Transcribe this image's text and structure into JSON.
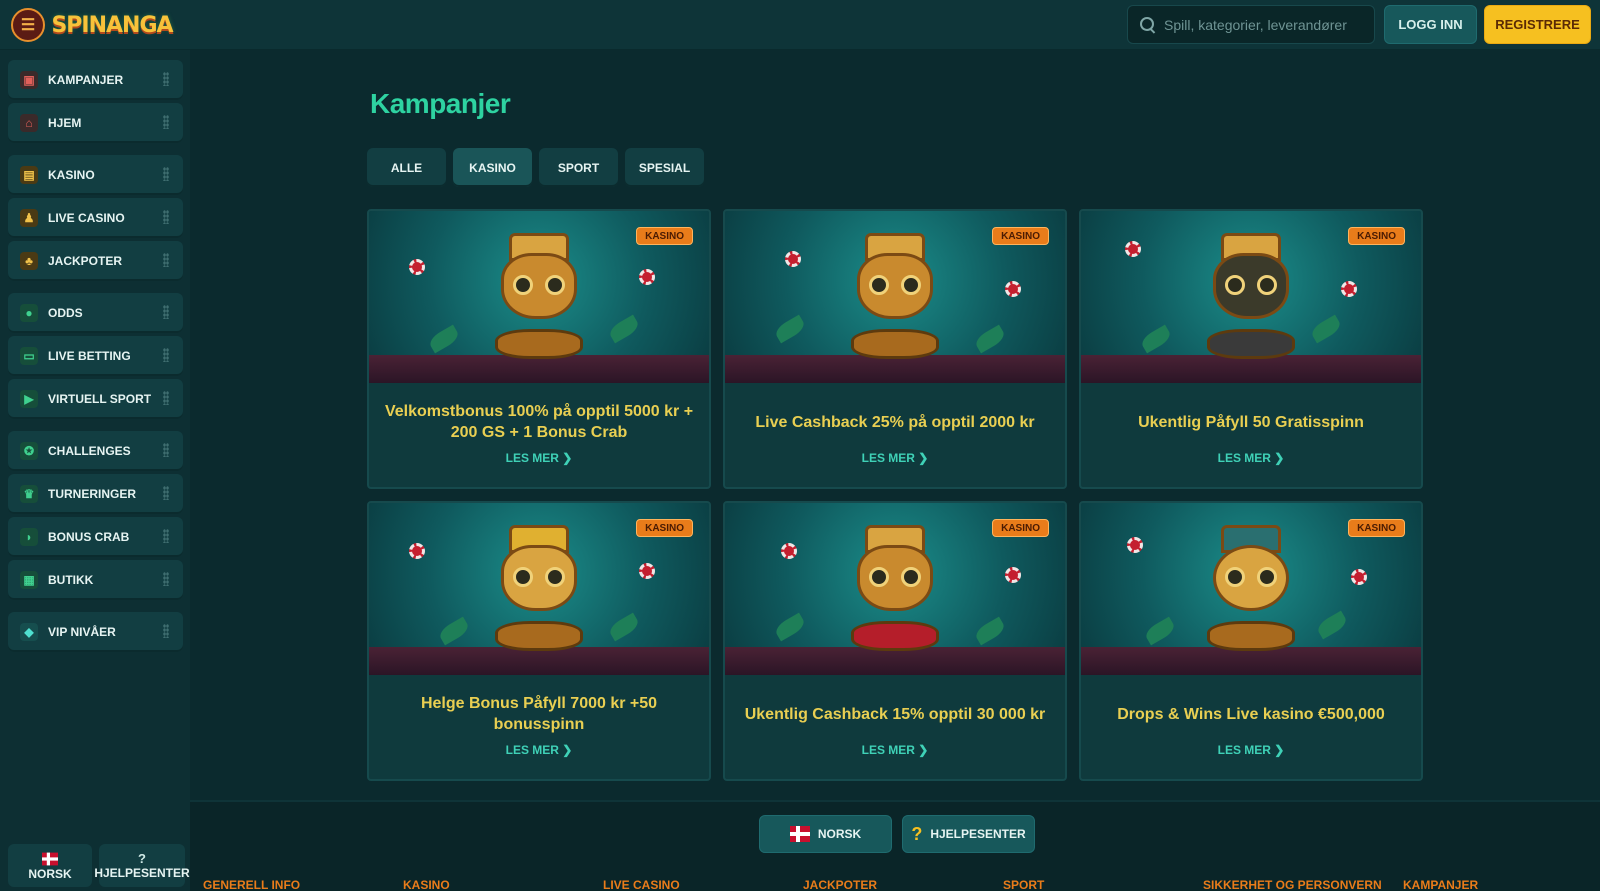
{
  "header": {
    "logo_text": "SPINANGA",
    "search_placeholder": "Spill, kategorier, leverandører",
    "login_label": "LOGG INN",
    "register_label": "REGISTRERE",
    "brand_color": "#f6c020",
    "accent_color": "#2ed3a1"
  },
  "sidebar": {
    "items": [
      {
        "label": "KAMPANJER",
        "icon": "gift-icon"
      },
      {
        "label": "HJEM",
        "icon": "home-icon"
      },
      {
        "label": "KASINO",
        "icon": "slot-icon"
      },
      {
        "label": "LIVE CASINO",
        "icon": "dealer-icon"
      },
      {
        "label": "JACKPOTER",
        "icon": "clover-icon"
      },
      {
        "label": "ODDS",
        "icon": "ball-icon"
      },
      {
        "label": "LIVE BETTING",
        "icon": "live-icon"
      },
      {
        "label": "VIRTUELL SPORT",
        "icon": "play-icon"
      },
      {
        "label": "CHALLENGES",
        "icon": "medal-icon"
      },
      {
        "label": "TURNERINGER",
        "icon": "trophy-icon"
      },
      {
        "label": "BONUS CRAB",
        "icon": "crab-icon"
      },
      {
        "label": "BUTIKK",
        "icon": "shop-icon"
      },
      {
        "label": "VIP NIVÅER",
        "icon": "diamond-icon"
      }
    ],
    "bottom_language": "NORSK",
    "bottom_help": "HJELPESENTER"
  },
  "main": {
    "title": "Kampanjer",
    "tabs": [
      {
        "label": "ALLE",
        "active": false
      },
      {
        "label": "KASINO",
        "active": true
      },
      {
        "label": "SPORT",
        "active": false
      },
      {
        "label": "SPESIAL",
        "active": false
      }
    ],
    "cards": [
      {
        "badge": "KASINO",
        "title": "Velkomstbonus 100% på opptil 5000 kr + 200 GS + 1 Bonus Crab",
        "more": "LES MER ❯"
      },
      {
        "badge": "KASINO",
        "title": "Live Cashback 25% på opptil 2000 kr",
        "more": "LES MER ❯"
      },
      {
        "badge": "KASINO",
        "title": "Ukentlig Påfyll 50 Gratisspinn",
        "more": "LES MER ❯"
      },
      {
        "badge": "KASINO",
        "title": "Helge Bonus Påfyll 7000 kr +50 bonusspinn",
        "more": "LES MER ❯"
      },
      {
        "badge": "KASINO",
        "title": "Ukentlig Cashback 15% opptil 30 000 kr",
        "more": "LES MER ❯"
      },
      {
        "badge": "KASINO",
        "title": "Drops & Wins Live kasino €500,000",
        "more": "LES MER ❯"
      }
    ]
  },
  "footer": {
    "language_button": "NORSK",
    "help_button": "HJELPESENTER",
    "links": [
      "GENERELL INFO",
      "KASINO",
      "LIVE CASINO",
      "JACKPOTER",
      "SPORT",
      "SIKKERHET OG PERSONVERN",
      "KAMPANJER"
    ]
  }
}
